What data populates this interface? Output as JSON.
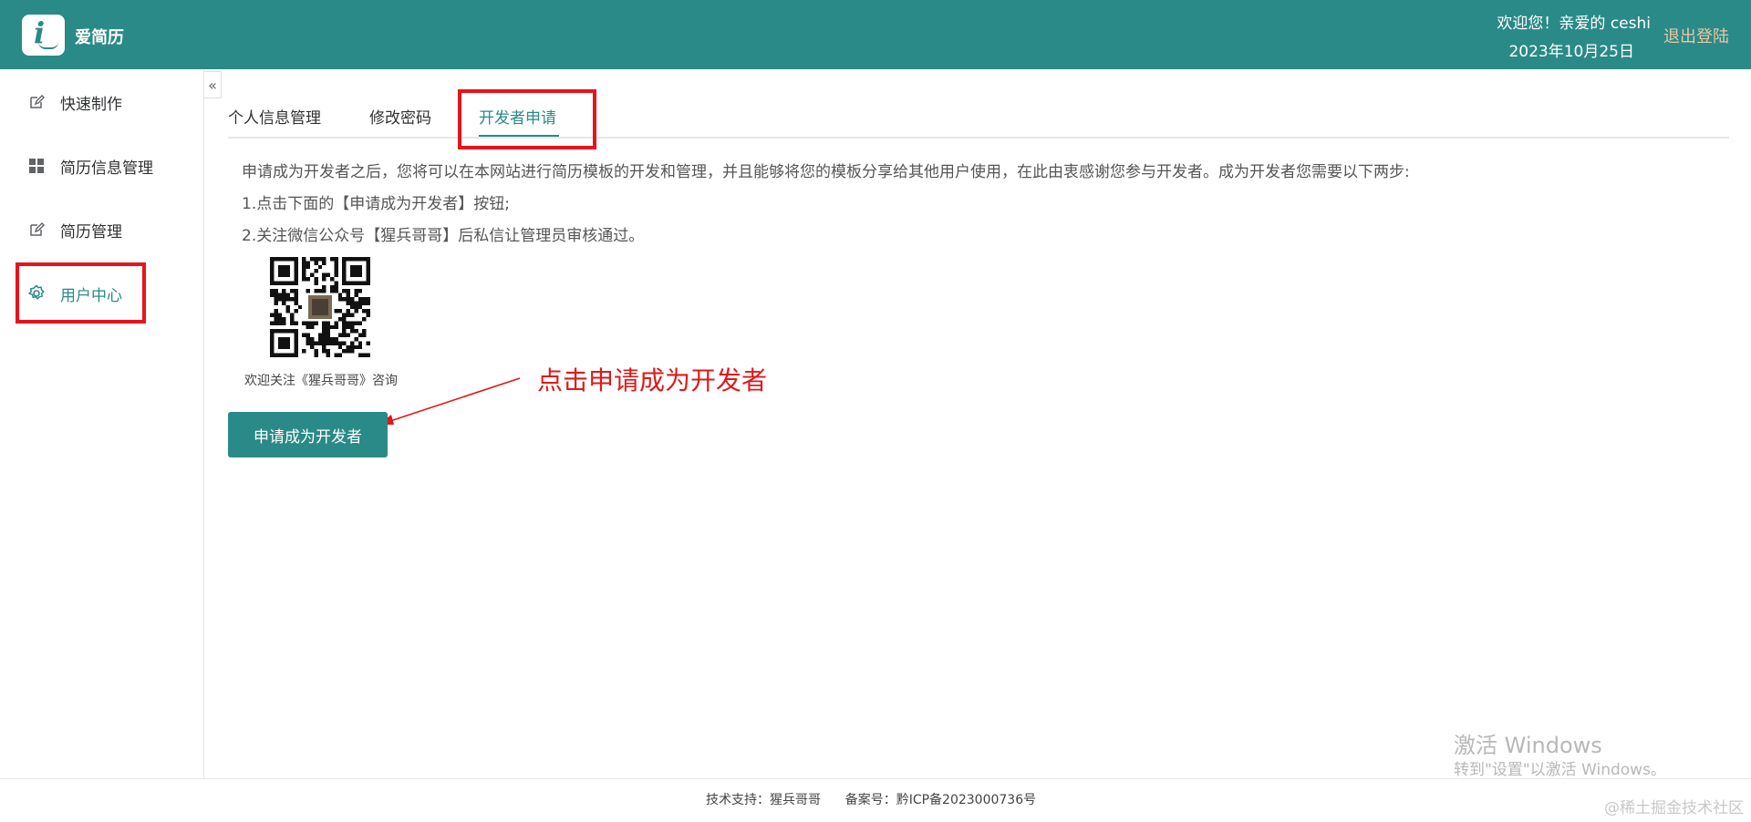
{
  "header": {
    "app_name": "爱简历",
    "welcome": "欢迎您！亲爱的 ceshi",
    "date": "2023年10月25日",
    "logout": "退出登陆",
    "brand_color": "#2a8a88"
  },
  "sidebar": {
    "items": [
      {
        "label": "快速制作",
        "icon": "edit-icon"
      },
      {
        "label": "简历信息管理",
        "icon": "grid-icon"
      },
      {
        "label": "简历管理",
        "icon": "edit-icon"
      },
      {
        "label": "用户中心",
        "icon": "gear-icon",
        "active": true
      }
    ],
    "collapse_glyph": "«"
  },
  "tabs": [
    {
      "label": "个人信息管理"
    },
    {
      "label": "修改密码"
    },
    {
      "label": "开发者申请",
      "active": true
    }
  ],
  "content": {
    "intro": "申请成为开发者之后，您将可以在本网站进行简历模板的开发和管理，并且能够将您的模板分享给其他用户使用，在此由衷感谢您参与开发者。成为开发者您需要以下两步:",
    "step1": "1.点击下面的【申请成为开发者】按钮;",
    "step2": "2.关注微信公众号【猩兵哥哥】后私信让管理员审核通过。",
    "qr_caption": "欢迎关注《猩兵哥哥》咨询",
    "apply_button": "申请成为开发者",
    "annotation": "点击申请成为开发者",
    "annotation_color": "#e01818"
  },
  "footer": {
    "support": "技术支持：猩兵哥哥",
    "icp": "备案号：黔ICP备2023000736号"
  },
  "overlay": {
    "activate_title": "激活 Windows",
    "activate_sub": "转到\"设置\"以激活 Windows。",
    "watermark": "@稀土掘金技术社区"
  }
}
